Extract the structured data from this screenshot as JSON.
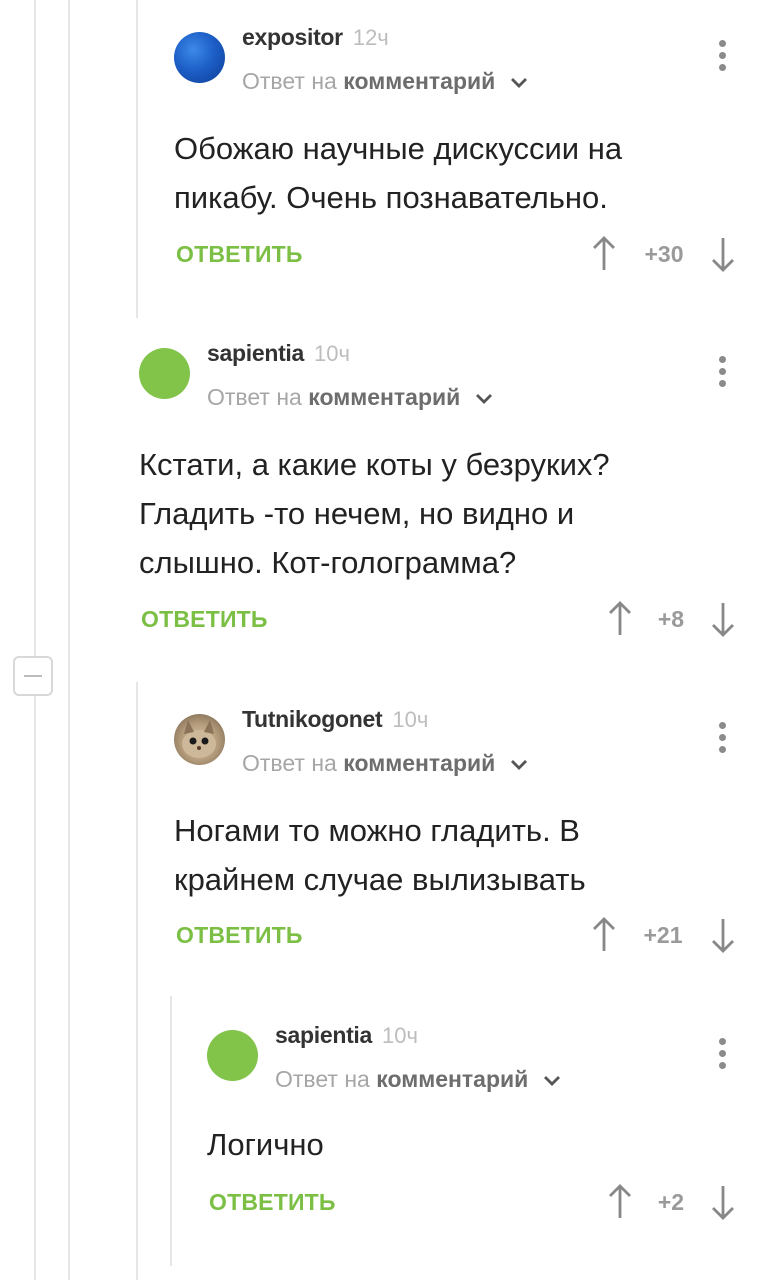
{
  "comments": [
    {
      "author": "expositor",
      "time": "12ч",
      "reply_prefix": "Ответ на",
      "reply_link": "комментарий",
      "avatar": "blue-avatar",
      "lines": [
        "Обожаю научные дискуссии на",
        "пикабу. Очень познавательно."
      ],
      "reply_label": "ОТВЕТИТЬ",
      "score": "+30"
    },
    {
      "author": "sapientia",
      "time": "10ч",
      "reply_prefix": "Ответ на",
      "reply_link": "комментарий",
      "avatar": "green-avatar",
      "lines": [
        "Кстати, а какие коты у безруких?",
        "Гладить -то нечем, но видно и",
        "слышно. Кот-голограмма?"
      ],
      "reply_label": "ОТВЕТИТЬ",
      "score": "+8"
    },
    {
      "author": "Tutnikogonet",
      "time": "10ч",
      "reply_prefix": "Ответ на",
      "reply_link": "комментарий",
      "avatar": "cat-avatar",
      "lines": [
        "Ногами то можно гладить. В",
        "крайнем случае вылизывать"
      ],
      "reply_label": "ОТВЕТИТЬ",
      "score": "+21"
    },
    {
      "author": "sapientia",
      "time": "10ч",
      "reply_prefix": "Ответ на",
      "reply_link": "комментарий",
      "avatar": "green-avatar",
      "lines": [
        "Логично"
      ],
      "reply_label": "ОТВЕТИТЬ",
      "score": "+2"
    }
  ],
  "colors": {
    "accent": "#7cbf45",
    "avatar_green": "#82c34a",
    "thread_line": "#e6e6e6"
  },
  "icons": [
    "collapse-icon",
    "menu-dots-icon",
    "chevron-down-icon",
    "arrow-up-icon",
    "arrow-down-icon"
  ]
}
